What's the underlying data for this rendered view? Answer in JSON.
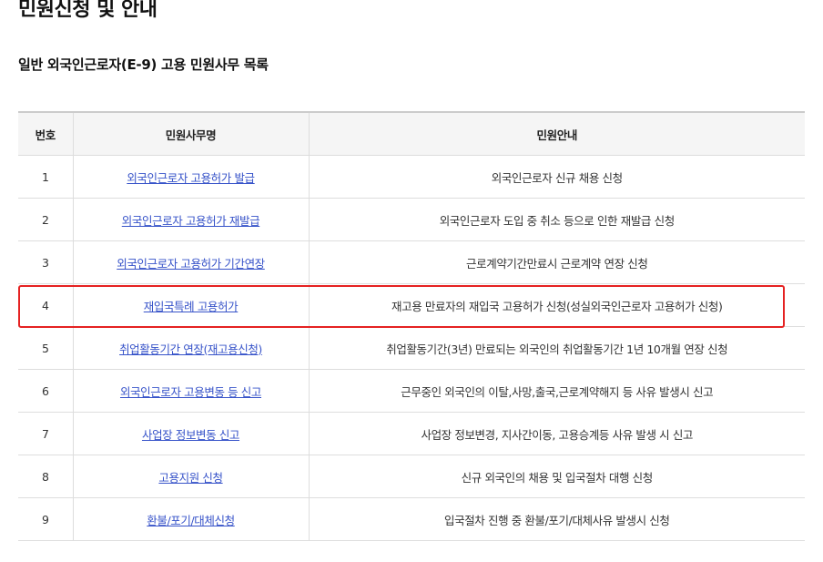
{
  "page": {
    "title": "민원신청 및 안내",
    "section_title": "일반 외국인근로자(E-9) 고용 민원사무 목록",
    "highlight_color": "#e52222",
    "link_color": "#3753c9"
  },
  "table": {
    "headers": {
      "no": "번호",
      "name": "민원사무명",
      "desc": "민원안내"
    },
    "rows": [
      {
        "no": "1",
        "name": "외국인근로자 고용허가 발급",
        "desc": "외국인근로자 신규 채용 신청"
      },
      {
        "no": "2",
        "name": "외국인근로자 고용허가 재발급",
        "desc": "외국인근로자 도입 중 취소 등으로 인한 재발급 신청"
      },
      {
        "no": "3",
        "name": "외국인근로자 고용허가 기간연장",
        "desc": "근로계약기간만료시 근로계약 연장 신청"
      },
      {
        "no": "4",
        "name": "재입국특례 고용허가",
        "desc": "재고용 만료자의 재입국 고용허가 신청(성실외국인근로자 고용허가 신청)",
        "highlighted": true
      },
      {
        "no": "5",
        "name": "취업활동기간 연장(재고용신청)",
        "desc": "취업활동기간(3년) 만료되는 외국인의 취업활동기간 1년 10개월 연장 신청"
      },
      {
        "no": "6",
        "name": "외국인근로자 고용변동 등 신고",
        "desc": "근무중인 외국인의 이탈,사망,출국,근로계약해지 등 사유 발생시 신고"
      },
      {
        "no": "7",
        "name": "사업장 정보변동 신고",
        "desc": "사업장 정보변경, 지사간이동, 고용승계등 사유 발생 시 신고"
      },
      {
        "no": "8",
        "name": "고용지원 신청",
        "desc": "신규 외국인의 채용 및 입국절차 대행 신청"
      },
      {
        "no": "9",
        "name": "환불/포기/대체신청",
        "desc": "입국절차 진행 중 환불/포기/대체사유 발생시 신청"
      }
    ]
  }
}
